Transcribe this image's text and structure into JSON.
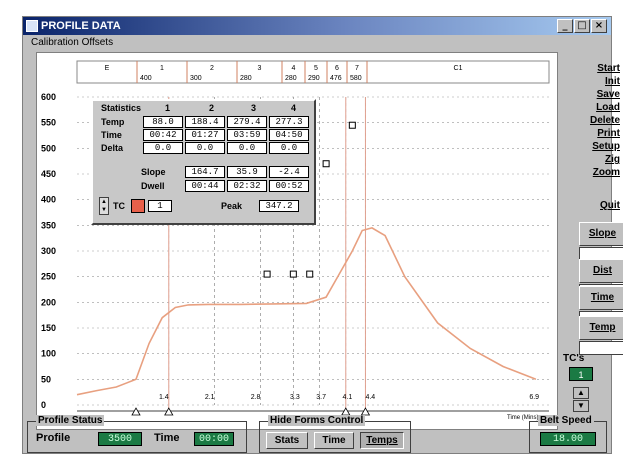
{
  "window": {
    "title": "PROFILE DATA",
    "menu": "Calibration Offsets",
    "min": "_",
    "max": "□",
    "close": "×"
  },
  "zones": [
    {
      "label": "E",
      "temp": ""
    },
    {
      "label": "1",
      "temp": "400"
    },
    {
      "label": "2",
      "temp": "300"
    },
    {
      "label": "3",
      "temp": "280"
    },
    {
      "label": "4",
      "temp": "280"
    },
    {
      "label": "5",
      "temp": "290"
    },
    {
      "label": "6",
      "temp": "476"
    },
    {
      "label": "7",
      "temp": "580"
    },
    {
      "label": "C1",
      "temp": ""
    }
  ],
  "statistics": {
    "title": "Statistics",
    "cols": [
      "1",
      "2",
      "3",
      "4"
    ],
    "row_labels": {
      "temp": "Temp",
      "time": "Time",
      "delta": "Delta",
      "slope": "Slope",
      "dwell": "Dwell",
      "tc": "TC",
      "peak": "Peak"
    },
    "temp": [
      "88.0",
      "188.4",
      "279.4",
      "277.3"
    ],
    "time": [
      "00:42",
      "01:27",
      "03:59",
      "04:50"
    ],
    "delta": [
      "0.0",
      "0.0",
      "0.0",
      "0.0"
    ],
    "slope": [
      "164.7",
      "35.9",
      "-2.4"
    ],
    "dwell": [
      "00:44",
      "02:32",
      "00:52"
    ],
    "tc_value": "1",
    "peak": "347.2"
  },
  "side_buttons": [
    "Start",
    "Init",
    "Save",
    "Load",
    "Delete",
    "Print",
    "Setup",
    "Zig",
    "Zoom"
  ],
  "quit": "Quit",
  "box_buttons": [
    "Slope",
    "Dist",
    "Time",
    "Temp"
  ],
  "tcs": {
    "label": "TC's",
    "value": "1",
    "up": "▲",
    "down": "▼"
  },
  "profile_status": {
    "title": "Profile Status",
    "profile_label": "Profile",
    "profile_value": "3500",
    "time_label": "Time",
    "time_value": "00:00"
  },
  "hide_forms": {
    "title": "Hide Forms Control",
    "buttons": [
      "Stats",
      "Time",
      "Temps"
    ]
  },
  "belt_speed": {
    "title": "Belt Speed",
    "value": "18.00"
  },
  "chart_data": {
    "type": "line",
    "xlabel": "Time (Mins)",
    "ylim": [
      0,
      600
    ],
    "y_ticks": [
      0,
      50,
      100,
      150,
      200,
      250,
      300,
      350,
      400,
      450,
      500,
      550,
      600
    ],
    "x_tick_labels": [
      "1.4",
      "2.1",
      "2.8",
      "3.3",
      "3.7",
      "4.1",
      "4.4",
      "6.9"
    ],
    "series": [
      {
        "color": "#e8a080",
        "x": [
          0.0,
          0.3,
          0.6,
          0.9,
          1.1,
          1.3,
          1.5,
          1.7,
          2.0,
          2.5,
          3.0,
          3.5,
          3.8,
          4.0,
          4.2,
          4.35,
          4.5,
          4.7,
          5.0,
          5.5,
          6.0,
          6.5,
          7.0
        ],
        "y": [
          20,
          28,
          35,
          50,
          120,
          170,
          190,
          195,
          196,
          196,
          197,
          198,
          210,
          255,
          300,
          340,
          345,
          330,
          250,
          160,
          110,
          75,
          50
        ]
      }
    ],
    "markers": [
      {
        "x": 2.9,
        "y": 255
      },
      {
        "x": 3.3,
        "y": 255
      },
      {
        "x": 3.55,
        "y": 255
      },
      {
        "x": 3.8,
        "y": 470
      },
      {
        "x": 4.2,
        "y": 545
      }
    ]
  }
}
